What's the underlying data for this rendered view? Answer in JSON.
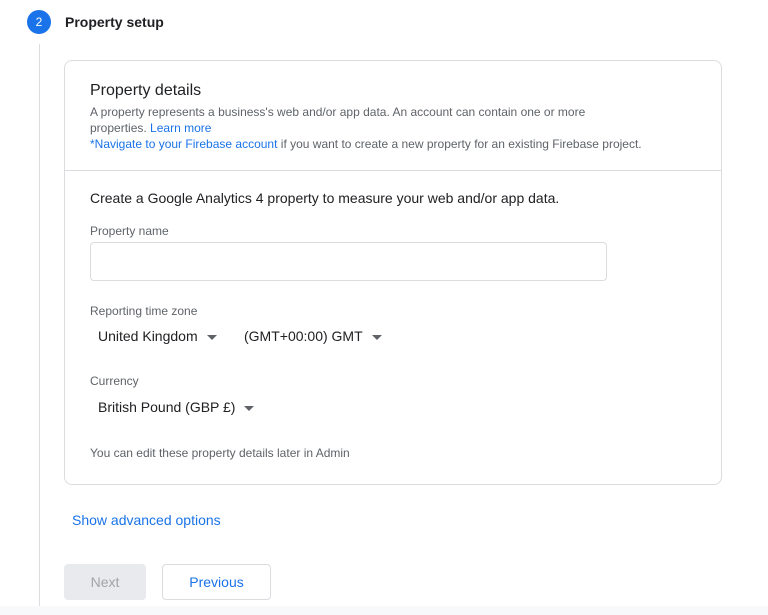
{
  "step": {
    "number": "2",
    "title": "Property setup"
  },
  "property_details": {
    "title": "Property details",
    "desc_line1": "A property represents a business's web and/or app data. An account can contain one or more",
    "desc_line2_text": "properties.",
    "learn_more": "Learn more",
    "firebase_link": "*Navigate to your Firebase account",
    "firebase_rest": " if you want to create a new property for an existing Firebase project."
  },
  "form": {
    "subtitle": "Create a Google Analytics 4 property to measure your web and/or app data.",
    "property_name_label": "Property name",
    "property_name_value": "",
    "property_name_placeholder": "",
    "timezone_label": "Reporting time zone",
    "timezone_country": "United Kingdom",
    "timezone_offset": "(GMT+00:00) GMT",
    "currency_label": "Currency",
    "currency_value": "British Pound (GBP £)",
    "note": "You can edit these property details later in Admin"
  },
  "advanced_options": "Show advanced options",
  "buttons": {
    "next": "Next",
    "previous": "Previous"
  },
  "colors": {
    "accent": "#1a73e8",
    "border": "#dadce0",
    "secondary_text": "#5f6368",
    "disabled_bg": "#e8eaed"
  }
}
